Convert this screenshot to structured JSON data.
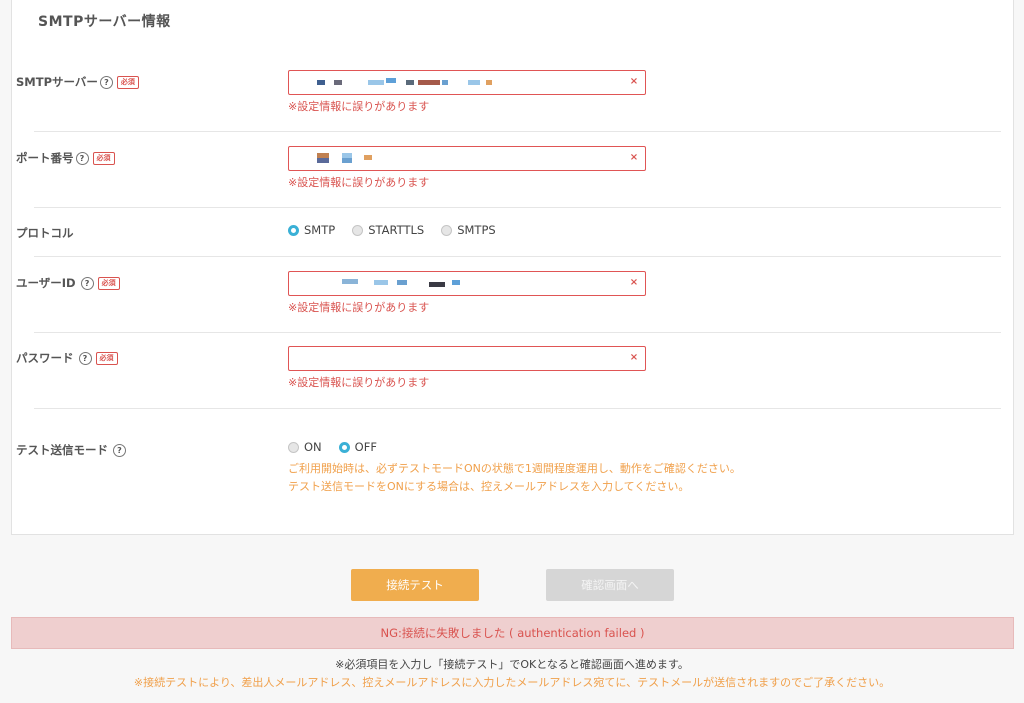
{
  "section": {
    "title": "SMTPサーバー情報"
  },
  "fields": {
    "smtp_server": {
      "label": "SMTPサーバー",
      "required": "必須",
      "value": "",
      "error": "※設定情報に誤りがあります"
    },
    "port": {
      "label": "ポート番号",
      "required": "必須",
      "value": "",
      "error": "※設定情報に誤りがあります"
    },
    "protocol": {
      "label": "プロトコル",
      "options": [
        "SMTP",
        "STARTTLS",
        "SMTPS"
      ],
      "selected": "SMTP"
    },
    "user_id": {
      "label": "ユーザーID",
      "required": "必須",
      "value": "",
      "error": "※設定情報に誤りがあります"
    },
    "password": {
      "label": "パスワード",
      "required": "必須",
      "value": "",
      "error": "※設定情報に誤りがあります"
    },
    "test_mode": {
      "label": "テスト送信モード",
      "options": [
        "ON",
        "OFF"
      ],
      "selected": "OFF",
      "note_line1": "ご利用開始時は、必ずテストモードONの状態で1週間程度運用し、動作をご確認ください。",
      "note_line2": "テスト送信モードをONにする場合は、控えメールアドレスを入力してください。"
    }
  },
  "icons": {
    "help": "?",
    "clear": "×"
  },
  "buttons": {
    "connect_test": "接続テスト",
    "confirm": "確認画面へ"
  },
  "alert": {
    "message": "NG:接続に失敗しました ( authentication failed )"
  },
  "footnotes": {
    "line1": "※必須項目を入力し「接続テスト」でOKとなると確認画面へ進めます。",
    "line2": "※接続テストにより、差出人メールアドレス、控えメールアドレスに入力したメールアドレス宛てに、テストメールが送信されますのでご了承ください。"
  },
  "colors": {
    "accent": "#3ab0d6",
    "error": "#d9534f",
    "warning": "#f0a04b",
    "button_primary": "#f0ad4e",
    "button_disabled": "#d6d6d6",
    "alert_bg": "#efcfcf"
  }
}
